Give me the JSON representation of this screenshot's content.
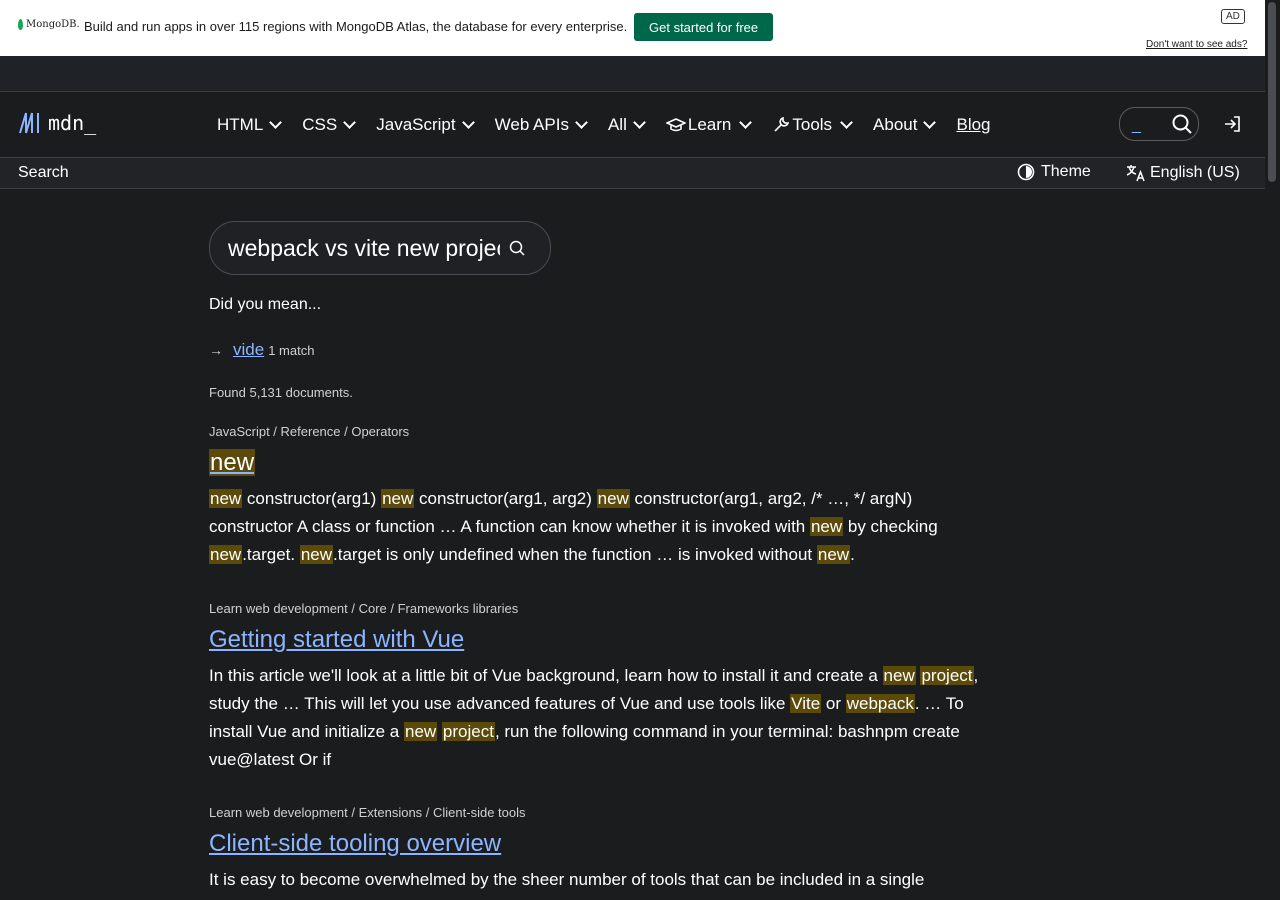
{
  "ad": {
    "brand": "MongoDB.",
    "text": "Build and run apps in over 115 regions with MongoDB Atlas, the database for every enterprise.",
    "cta": "Get started for free",
    "badge": "AD",
    "hide_link": "Don't want to see ads?"
  },
  "nav": {
    "logo_text": "mdn_",
    "items": [
      {
        "label": "HTML"
      },
      {
        "label": "CSS"
      },
      {
        "label": "JavaScript"
      },
      {
        "label": "Web APIs"
      },
      {
        "label": "All"
      },
      {
        "label": "Learn"
      },
      {
        "label": "Tools"
      },
      {
        "label": "About"
      }
    ],
    "blog": "Blog",
    "search_cursor": "_"
  },
  "subnav": {
    "crumb": "Search",
    "theme": "Theme",
    "language": "English (US)"
  },
  "search": {
    "query": "webpack vs vite new project"
  },
  "suggestion": {
    "heading": "Did you mean...",
    "arrow": "→",
    "term": "vide",
    "count": "1 match"
  },
  "found": "Found 5,131 documents.",
  "results": [
    {
      "path": "JavaScript / Reference / Operators",
      "title": "new",
      "desc_html": "<mark>new</mark> constructor(arg1) <mark>new</mark> constructor(arg1, arg2) <mark>new</mark> constructor(arg1, arg2, /* …, */ argN) constructor A class or function … A function can know whether it is invoked with <mark>new</mark> by checking <mark>new</mark>.target. <mark>new</mark>.target is only undefined when the function … is invoked without <mark>new</mark>."
    },
    {
      "path": "Learn web development / Core / Frameworks libraries",
      "title": "Getting started with Vue",
      "desc_html": "In this article we'll look at a little bit of Vue background, learn how to install it and create a <mark>new</mark> <mark>project</mark>, study the … This will let you use advanced features of Vue and use tools like <mark>Vite</mark> or <mark>webpack</mark>. … To install Vue and initialize a <mark>new</mark> <mark>project</mark>, run the following command in your terminal: bashnpm create vue@latest Or if"
    },
    {
      "path": "Learn web development / Extensions / Client-side tools",
      "title": "Client-side tooling overview",
      "desc_html": "It is easy to become overwhelmed by the sheer number of tools that can be included in a single"
    }
  ]
}
